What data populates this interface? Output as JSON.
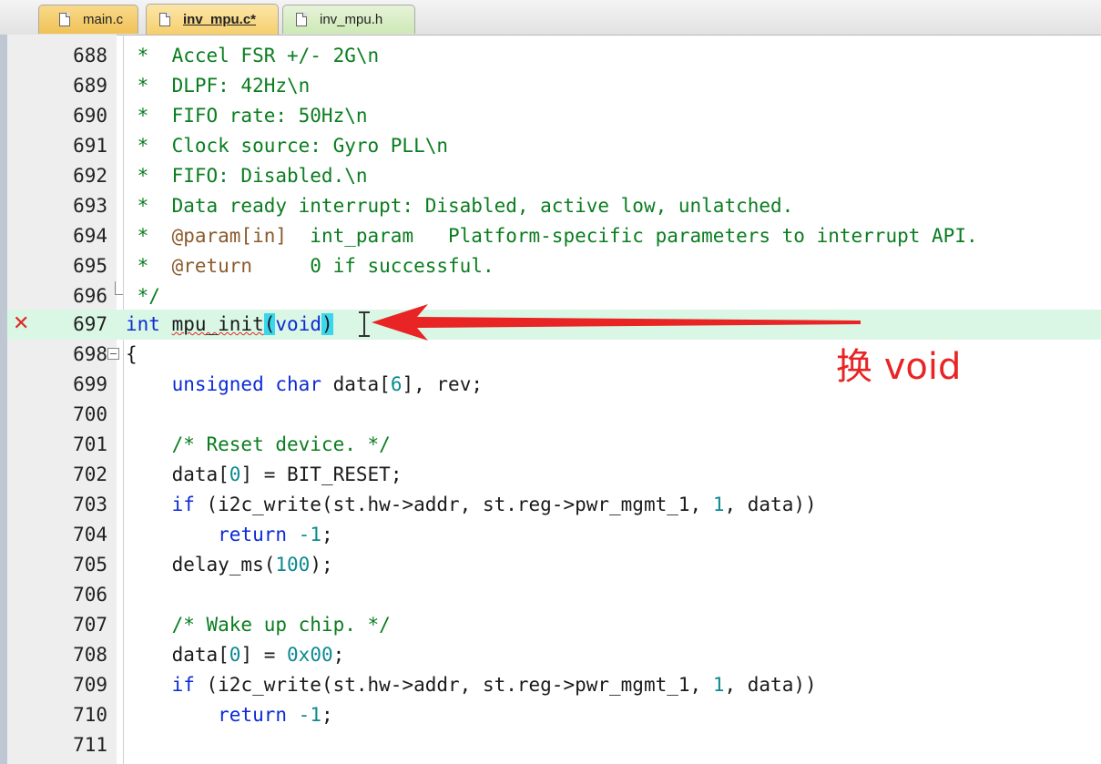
{
  "tabs": [
    {
      "label": "main.c"
    },
    {
      "label": "inv_mpu.c*"
    },
    {
      "label": "inv_mpu.h"
    }
  ],
  "lines": [
    {
      "n": "688",
      "text": " *  Accel FSR +/- 2G\\n"
    },
    {
      "n": "689",
      "text": " *  DLPF: 42Hz\\n"
    },
    {
      "n": "690",
      "text": " *  FIFO rate: 50Hz\\n"
    },
    {
      "n": "691",
      "text": " *  Clock source: Gyro PLL\\n"
    },
    {
      "n": "692",
      "text": " *  FIFO: Disabled.\\n"
    },
    {
      "n": "693",
      "text": " *  Data ready interrupt: Disabled, active low, unlatched."
    },
    {
      "n": "694",
      "tag": "@param[in]",
      "text": "  int_param   Platform-specific parameters to interrupt API."
    },
    {
      "n": "695",
      "tag": "@return",
      "text": "     0 if successful."
    },
    {
      "n": "696",
      "text": " */"
    },
    {
      "n": "697",
      "kw": "int",
      "fn": "mpu_init",
      "open": "(",
      "arg": "void",
      "close": ")"
    },
    {
      "n": "698",
      "text": "{"
    },
    {
      "n": "699",
      "kw1": "unsigned",
      "kw2": "char",
      "pre": " data[",
      "num": "6",
      "post": "], rev;"
    },
    {
      "n": "700"
    },
    {
      "n": "701",
      "text": "    /* Reset device. */"
    },
    {
      "n": "702",
      "pre": "    data[",
      "num": "0",
      "post": "] = BIT_RESET;"
    },
    {
      "n": "703",
      "kw": "if",
      "pre": " (i2c_write(st.hw->addr, st.reg->pwr_mgmt_1, ",
      "num": "1",
      "post": ", data))"
    },
    {
      "n": "704",
      "kw": "return",
      "num": "-1",
      "post": ";"
    },
    {
      "n": "705",
      "pre": "    delay_ms(",
      "num": "100",
      "post": ");"
    },
    {
      "n": "706"
    },
    {
      "n": "707",
      "text": "    /* Wake up chip. */"
    },
    {
      "n": "708",
      "pre": "    data[",
      "num": "0",
      "mid": "] = ",
      "num2": "0x00",
      "post": ";"
    },
    {
      "n": "709",
      "kw": "if",
      "pre": " (i2c_write(st.hw->addr, st.reg->pwr_mgmt_1, ",
      "num": "1",
      "post": ", data))"
    },
    {
      "n": "710",
      "kw": "return",
      "num": "-1",
      "post": ";"
    },
    {
      "n": "711"
    }
  ],
  "annotation": {
    "text": "换 void",
    "color": "#e82424"
  },
  "error_marker": {
    "line": "697",
    "icon": "error-x-icon",
    "color": "#e02828"
  },
  "colors": {
    "comment": "#0a7d1f",
    "keyword": "#0b2bd6",
    "number": "#0b8a92",
    "highlight": "#d9f7e4"
  }
}
